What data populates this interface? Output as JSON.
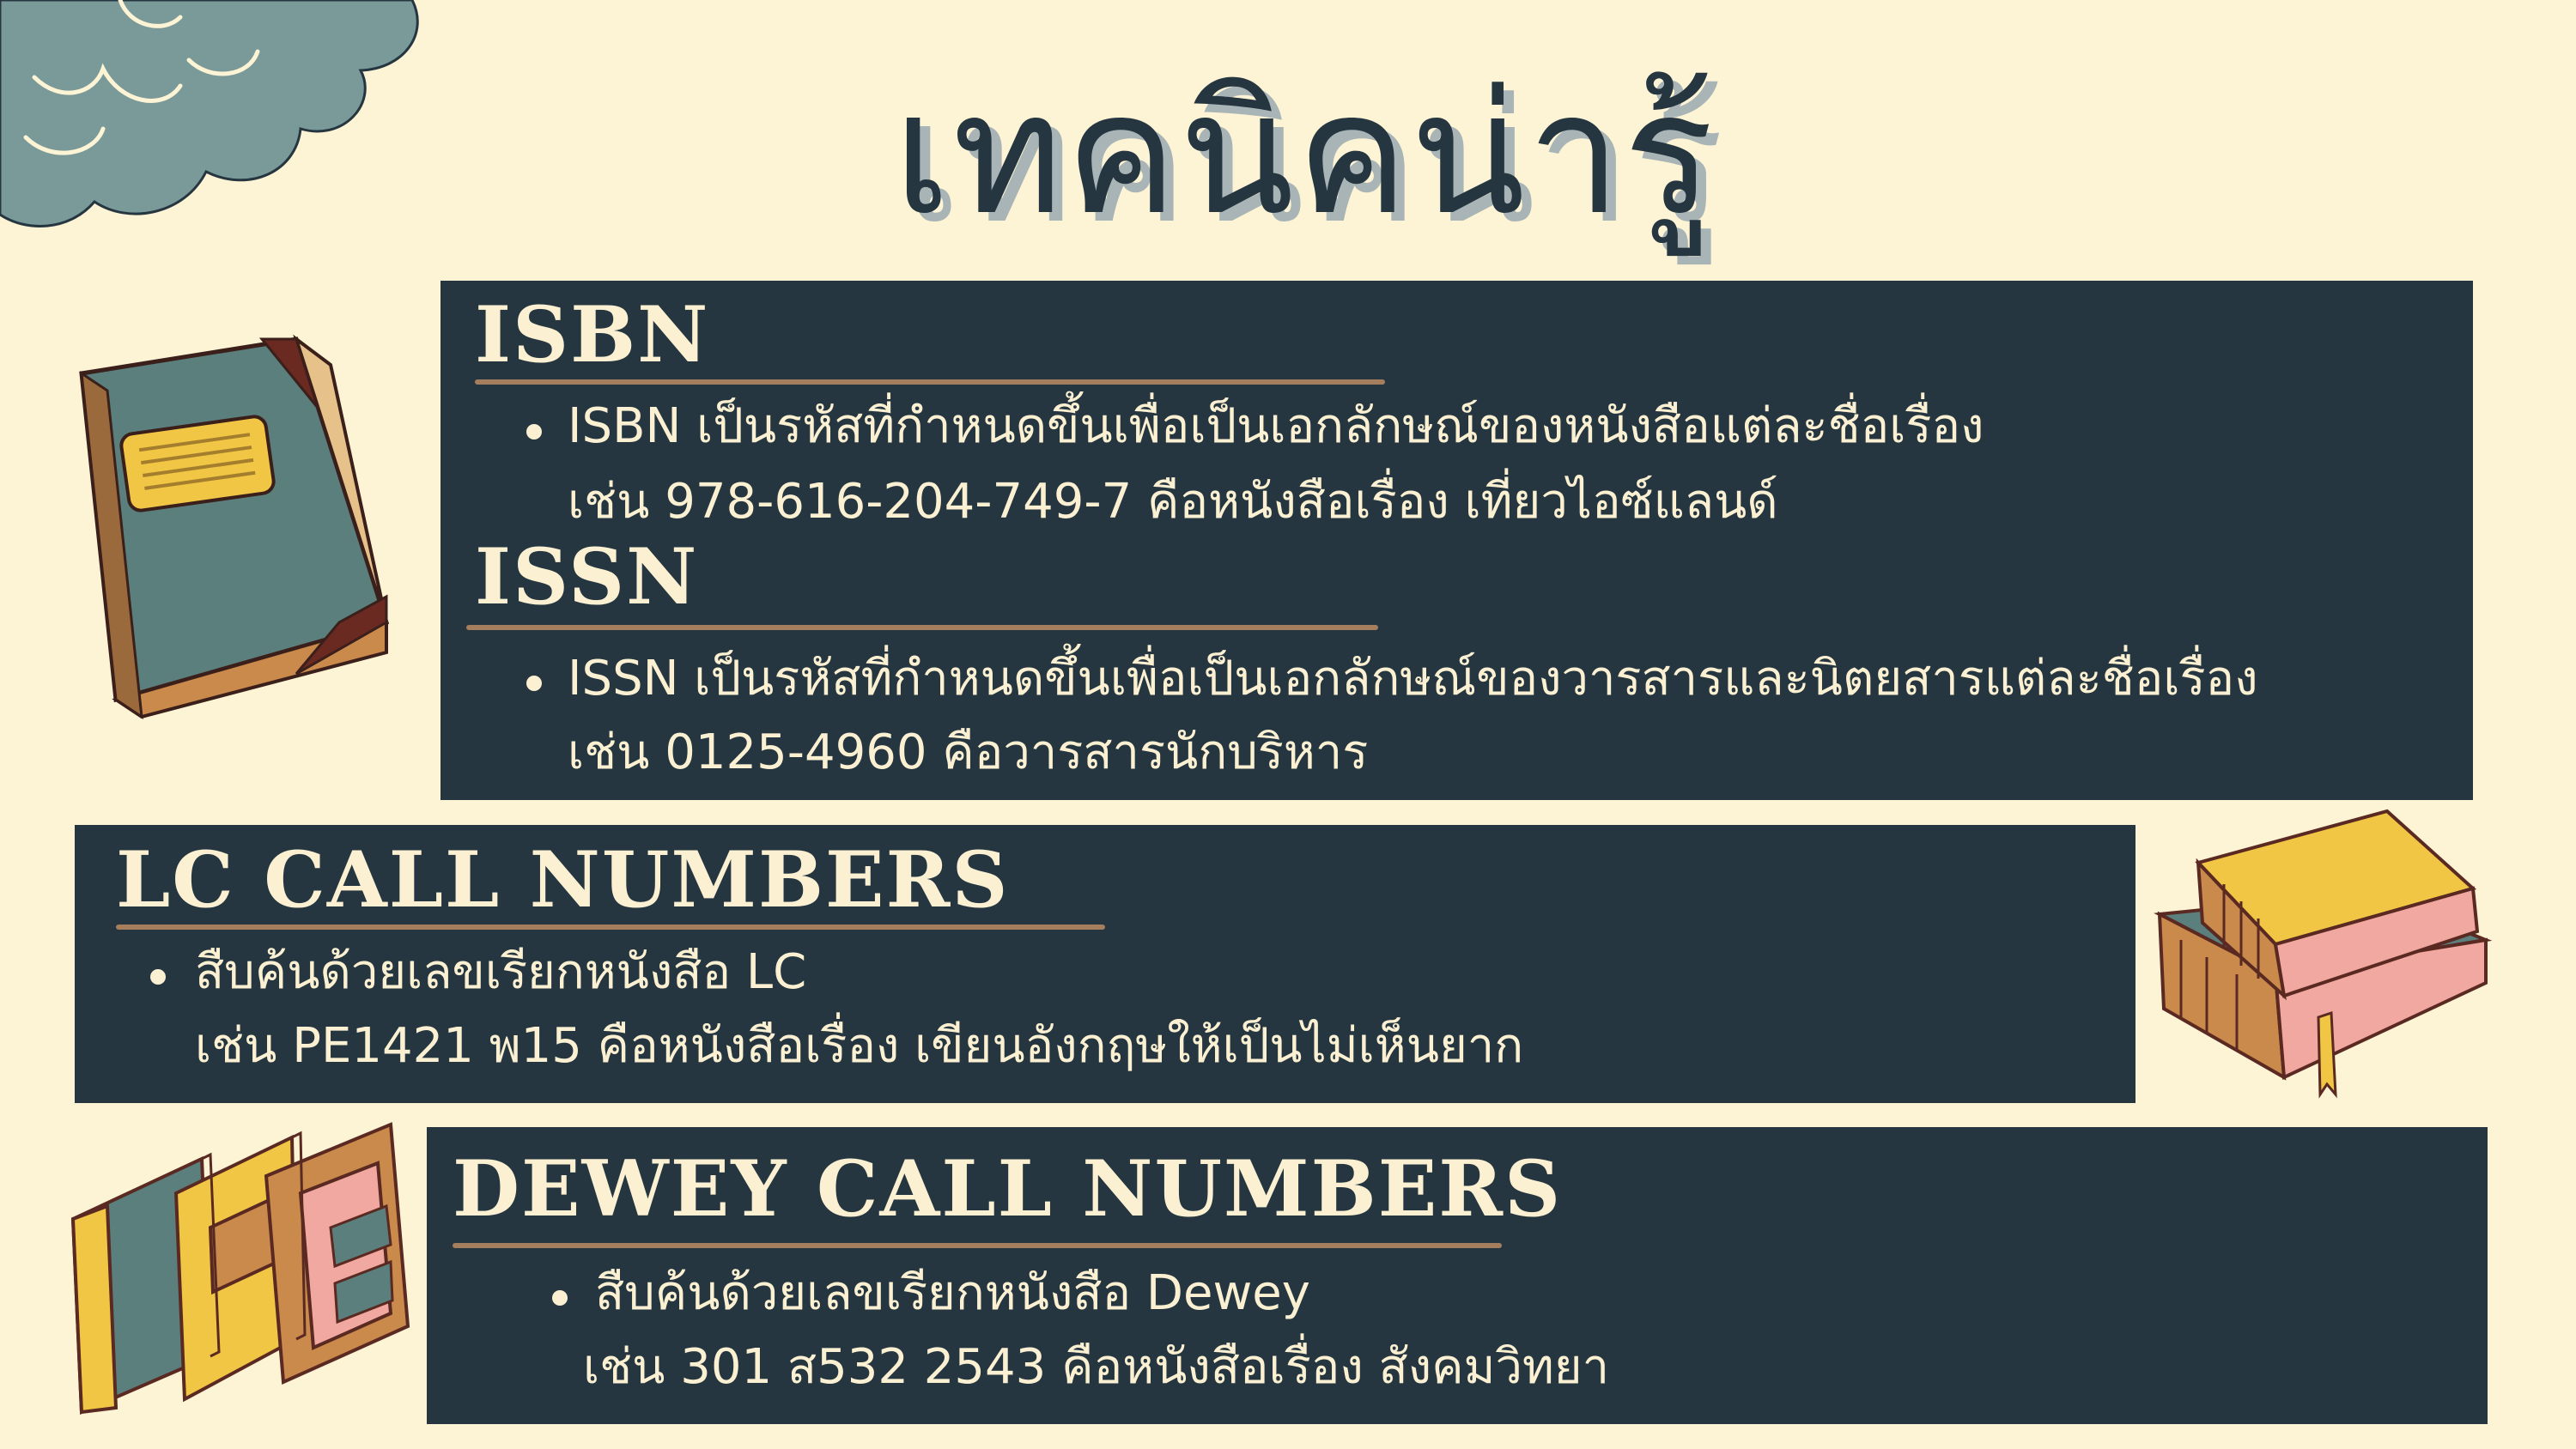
{
  "title": "เทคนิคน่ารู้",
  "isbn": {
    "heading": "ISBN",
    "lines": [
      "ISBN เป็นรหัสที่กำหนดขึ้นเพื่อเป็นเอกลักษณ์ของหนังสือแต่ละชื่อเรื่อง",
      "เช่น 978-616-204-749-7 คือหนังสือเรื่อง เที่ยวไอซ์แลนด์"
    ]
  },
  "issn": {
    "heading": "ISSN",
    "lines": [
      "ISSN เป็นรหัสที่กำหนดขึ้นเพื่อเป็นเอกลักษณ์ของวารสารและนิตยสารแต่ละชื่อเรื่อง",
      "เช่น 0125-4960 คือวารสารนักบริหาร"
    ]
  },
  "lc": {
    "heading": "LC CALL NUMBERS",
    "lines": [
      "สืบค้นด้วยเลขเรียกหนังสือ LC",
      "เช่น PE1421 พ15 คือหนังสือเรื่อง เขียนอังกฤษให้เป็นไม่เห็นยาก"
    ]
  },
  "dewey": {
    "heading": "DEWEY CALL NUMBERS",
    "lines": [
      "สืบค้นด้วยเลขเรียกหนังสือ Dewey",
      "เช่น 301 ส532 2543 คือหนังสือเรื่อง สังคมวิทยา"
    ]
  },
  "colors": {
    "background": "#fdf3d5",
    "panel": "#253641",
    "text_light": "#fbf1d2",
    "rule": "#a57e5d",
    "title": "#253641",
    "cloud": "#7a9999"
  },
  "icons": [
    "cloud-icon",
    "closed-book-icon",
    "stacked-books-icon",
    "open-books-icon"
  ]
}
